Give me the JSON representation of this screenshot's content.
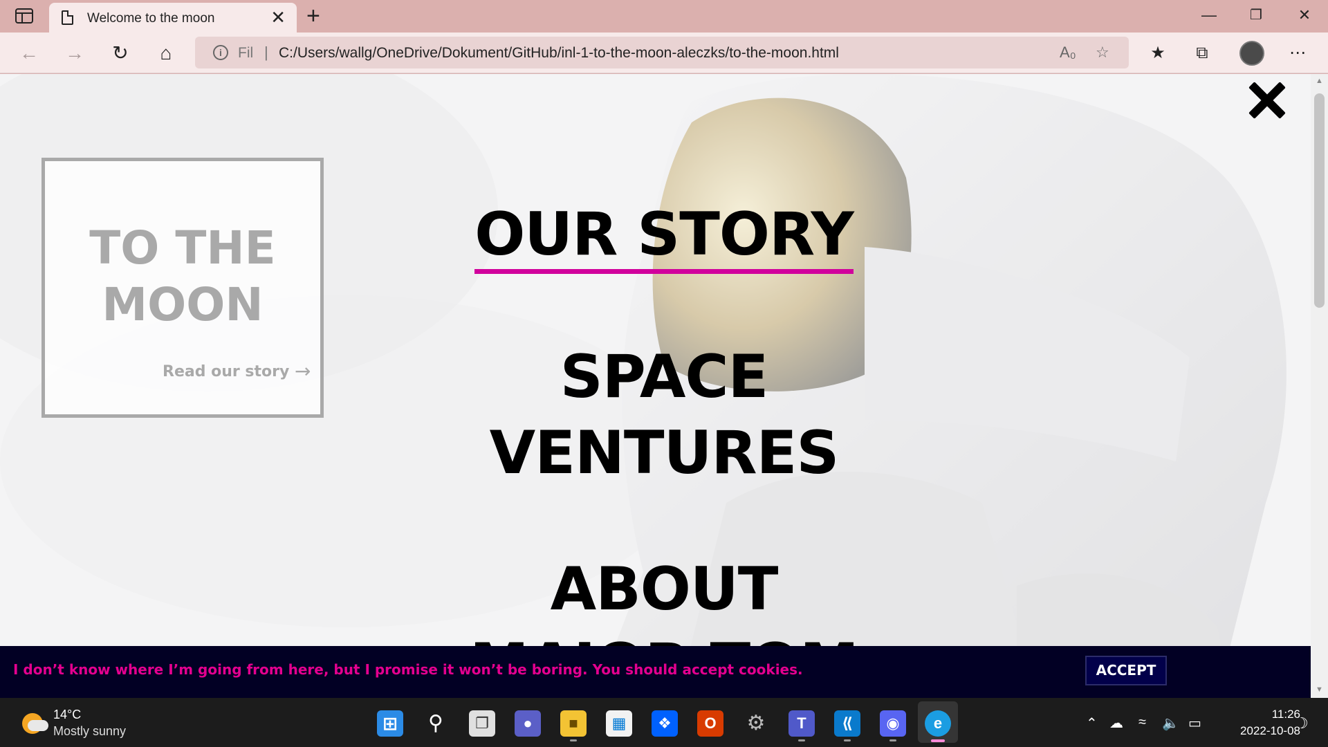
{
  "browser": {
    "tab_title": "Welcome to the moon",
    "new_tab_label": "+",
    "tab_close_label": "✕",
    "url_scheme_label": "Fil",
    "url": "C:/Users/wallg/OneDrive/Dokument/GitHub/inl-1-to-the-moon-aleczks/to-the-moon.html"
  },
  "page": {
    "card_title_line1": "TO THE",
    "card_title_line2": "MOON",
    "card_link": "Read our story",
    "card_link_arrow": "→",
    "menu_items": [
      "OUR STORY",
      "SPACE",
      "VENTURES",
      "ABOUT",
      "MAJOR TOM"
    ],
    "cookie_text": "I don’t know where I’m going from here, but I promise it won’t be boring. You should accept cookies.",
    "accept_label": "ACCEPT",
    "accent_color": "#d1009c"
  },
  "taskbar": {
    "weather_temp": "14°C",
    "weather_desc": "Mostly sunny",
    "clock_time": "11:26",
    "clock_date": "2022-10-08"
  }
}
